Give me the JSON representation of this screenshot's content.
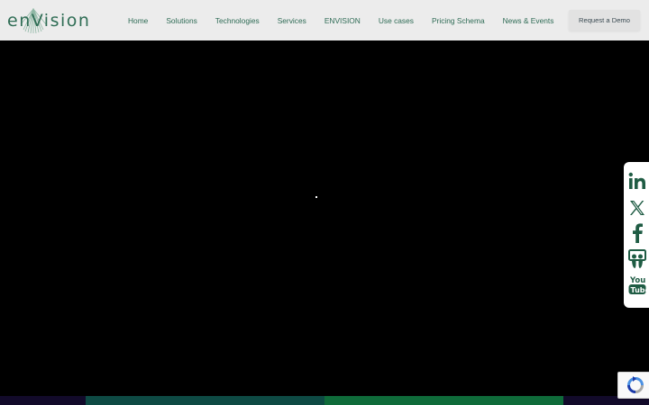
{
  "brand": {
    "logo_text": "enVision",
    "logo_alt_name": "ENVISION logo"
  },
  "nav": {
    "items": [
      {
        "label": "Home"
      },
      {
        "label": "Solutions"
      },
      {
        "label": "Technologies"
      },
      {
        "label": "Services"
      },
      {
        "label": "ENVISION"
      },
      {
        "label": "Use cases"
      },
      {
        "label": "Pricing Schema"
      },
      {
        "label": "News & Events"
      }
    ],
    "cta_label": "Request a Demo"
  },
  "social": {
    "icons": [
      {
        "name": "linkedin-icon",
        "glyph": "in"
      },
      {
        "name": "x-twitter-icon",
        "glyph": "X"
      },
      {
        "name": "facebook-icon",
        "glyph": "f"
      },
      {
        "name": "slideshare-icon",
        "glyph": ""
      },
      {
        "name": "youtube-icon",
        "glyph": "You Tube"
      }
    ]
  },
  "colors": {
    "brand_green": "#2e6b55",
    "header_bg": "#ececec",
    "hero_bg": "#000000",
    "icon_green": "#1f5c44",
    "strip": [
      "#120a2a",
      "#0e4a44",
      "#0f6b3a",
      "#120a2a"
    ]
  },
  "recaptcha": {
    "icon": "recaptcha-icon"
  }
}
